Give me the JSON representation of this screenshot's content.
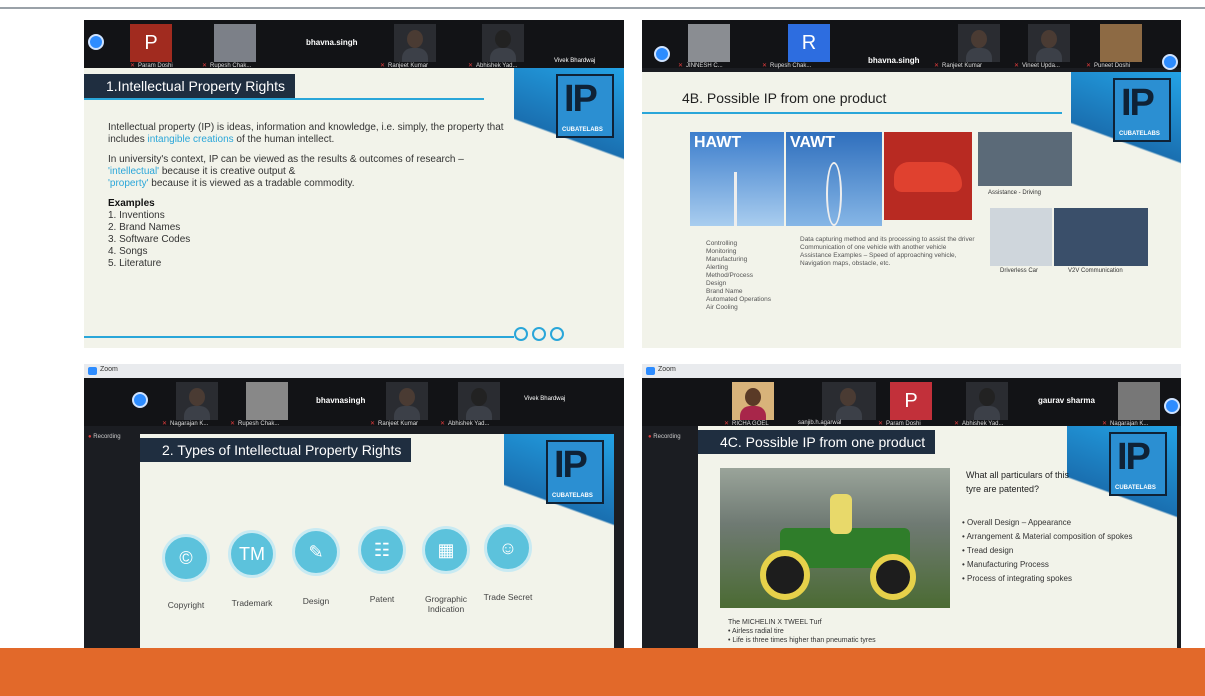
{
  "panels": {
    "p1": {
      "participants": [
        "Param Doshi",
        "Rupesh Chak...",
        "Ranjeet Kumar",
        "Abhishek Yad..."
      ],
      "host_name": "bhavna.singh",
      "right_name": "Vivek Bhardwaj",
      "avatar_letter": "P",
      "slide_title": "1.Intellectual Property Rights",
      "para1_a": "Intellectual property (IP) is ideas, information and knowledge, i.e. simply, the property that includes ",
      "para1_hl": "intangible creations",
      "para1_b": " of the human intellect.",
      "para2_a": "In university's context, IP can be viewed as the results & outcomes of research –",
      "para2_hl1": "'intellectual'",
      "para2_b": " because it is creative output &",
      "para2_hl2": "'property'",
      "para2_c": " because it is viewed as a tradable commodity.",
      "examples_heading": "Examples",
      "examples": [
        "1. Inventions",
        "2. Brand Names",
        "3. Software Codes",
        "4. Songs",
        "5. Literature"
      ],
      "logo_text": "IP",
      "logo_sub": "CUBATELABS"
    },
    "p2": {
      "participants": [
        "JINNESH C...",
        "Rupesh Chak...",
        "Ranjeet Kumar",
        "Vineet Upda...",
        "Puneet Doshi"
      ],
      "host_name": "bhavna.singh",
      "avatar_letter": "R",
      "slide_title": "4B. Possible IP from one product",
      "img_labels": [
        "HAWT",
        "VAWT"
      ],
      "captions": [
        "Assistance - Driving",
        "Driverless Car",
        "V2V Communication"
      ],
      "bullets_left": [
        "Controlling",
        "Monitoring",
        "Manufacturing",
        "Alerting",
        "Method/Process",
        "Design",
        "Brand Name",
        "Automated Operations",
        "Air Cooling"
      ],
      "bullets_right": [
        "Data capturing method and its processing to assist the driver",
        "Communication of one vehicle with another vehicle",
        "Assistance Examples – Speed of approaching vehicle, Navigation maps, obstacle, etc."
      ],
      "logo_text": "IP",
      "logo_sub": "CUBATELABS"
    },
    "p3": {
      "window_title": "Zoom",
      "recording_label": "Recording",
      "participants": [
        "Nagarajan K...",
        "Rupesh Chak...",
        "Ranjeet Kumar",
        "Abhishek Yad..."
      ],
      "host_name": "bhavnasingh",
      "right_name": "Vivek Bhardwaj",
      "slide_title": "2. Types of Intellectual Property Rights",
      "types": [
        {
          "glyph": "©",
          "label": "Copyright"
        },
        {
          "glyph": "TM",
          "label": "Trademark"
        },
        {
          "glyph": "✎",
          "label": "Design"
        },
        {
          "glyph": "☷",
          "label": "Patent"
        },
        {
          "glyph": "▦",
          "label": "Grographic Indication"
        },
        {
          "glyph": "☺",
          "label": "Trade Secret"
        }
      ],
      "logo_text": "IP",
      "logo_sub": "CUBATELABS"
    },
    "p4": {
      "window_title": "Zoom",
      "recording_label": "Recording",
      "participants": [
        "RICHA GOEL",
        "sanjib.h.agarwal",
        "Param Doshi",
        "Abhishek Yad...",
        "Nagarajan K..."
      ],
      "host_name": "gaurav sharma",
      "avatar_letter": "P",
      "slide_title": "4C. Possible IP from one product",
      "question": "What all particulars of this tyre are patented?",
      "features": [
        "Overall Design – Appearance",
        "Arrangement & Material composition of spokes",
        "Tread design",
        "Manufacturing Process",
        "Process of integrating spokes"
      ],
      "caption_title": "The MICHELIN X TWEEL Turf",
      "caption_bullets": [
        "Airless radial tire",
        "Life is three times higher than pneumatic tyres"
      ],
      "logo_text": "IP",
      "logo_sub": "CUBATELABS"
    }
  },
  "colors": {
    "footer_bar": "#e2692a",
    "accent_blue": "#2aa6d9",
    "title_bar": "#1f2e40"
  }
}
